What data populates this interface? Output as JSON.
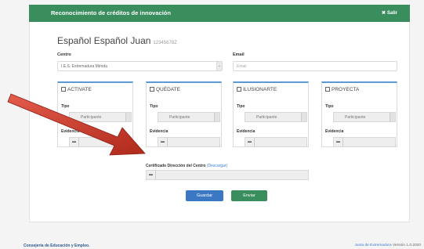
{
  "header": {
    "title": "Reconocimiento de créditos de innovación",
    "exit_icon": "close-icon",
    "exit_label": "Salir"
  },
  "user": {
    "name": "Español Español Juan",
    "id": "12345678Z"
  },
  "form": {
    "centro_label": "Centro",
    "centro_value": "I.E.S. Extremadura Mérida",
    "email_label": "Email",
    "email_placeholder": "Email"
  },
  "panels": [
    {
      "title": "ACTIVATE",
      "tipo_label": "Tipo",
      "tipo_value": "Participante",
      "evidencia_label": "Evidencia"
    },
    {
      "title": "QUÉDATE",
      "tipo_label": "Tipo",
      "tipo_value": "Participante",
      "evidencia_label": "Evidencia"
    },
    {
      "title": "ILUSIONARTE",
      "tipo_label": "Tipo",
      "tipo_value": "Participante",
      "evidencia_label": "Evidencia"
    },
    {
      "title": "PROYECTA",
      "tipo_label": "Tipo",
      "tipo_value": "Participante",
      "evidencia_label": "Evidencia"
    }
  ],
  "certificate": {
    "label": "Certificado Dirección del Centro",
    "download_link": "(Descargar)"
  },
  "buttons": {
    "save": "Guardar",
    "send": "Enviar"
  },
  "footer": {
    "left": "Consejería de Educación y Empleo.",
    "right": "Junta de Extremadura",
    "version": "Versión 1.0.2020"
  },
  "colors": {
    "header_green": "#3a8d5d",
    "save_blue": "#3a78c3",
    "send_green": "#3a8d5d",
    "panel_accent": "#5b9bd5",
    "arrow_red": "#c0392b"
  }
}
